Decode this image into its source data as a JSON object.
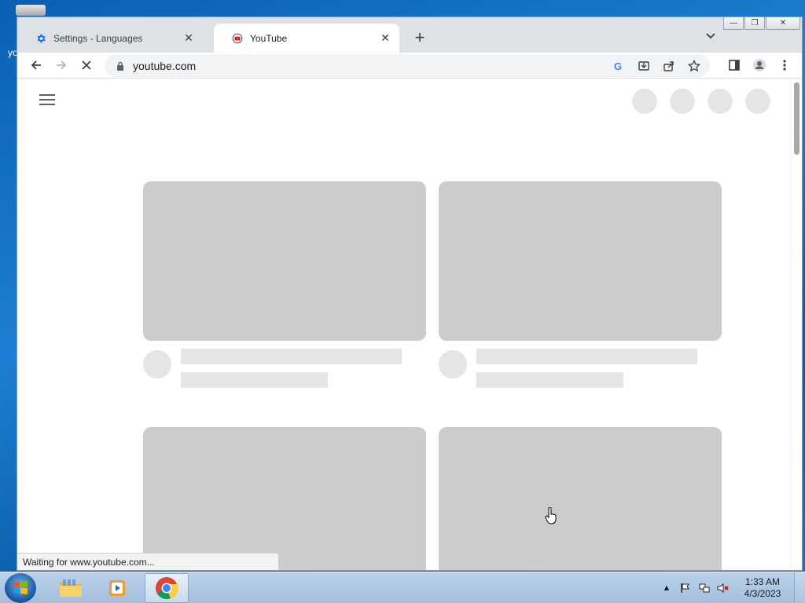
{
  "desktop": {
    "partial_text": "yo"
  },
  "browser": {
    "tabs": [
      {
        "title": "Settings - Languages",
        "favicon": "gear-icon",
        "active": false
      },
      {
        "title": "YouTube",
        "favicon": "youtube-icon",
        "active": true
      }
    ],
    "toolbar": {
      "url": "youtube.com",
      "loading": true
    },
    "status_text": "Waiting for www.youtube.com..."
  },
  "taskbar": {
    "apps": [
      "file-explorer-icon",
      "media-player-icon",
      "chrome-icon"
    ],
    "clock": {
      "time": "1:33 AM",
      "date": "4/3/2023"
    }
  },
  "colors": {
    "skeleton_thumb": "#cccccc",
    "skeleton_light": "#e5e5e5",
    "tabstrip": "#dee1e6",
    "youtube_red": "#ff0000"
  }
}
